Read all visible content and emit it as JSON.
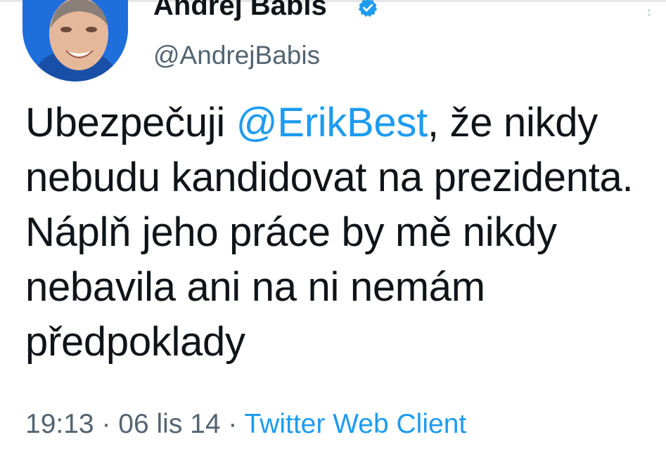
{
  "tweet": {
    "author": {
      "display_name": "Andrej Babiš",
      "handle": "@AndrejBabis",
      "verified": true,
      "verified_icon": "verified-badge-icon"
    },
    "text": {
      "before_mention": "Ubezpečuji ",
      "mention": "@ErikBest",
      "after_mention": ", že nikdy nebudu kandidovat na prezidenta. Náplň jeho práce by mě nikdy nebavila ani na ni nemám předpoklady"
    },
    "meta": {
      "time": "19:13",
      "separator_1": " · ",
      "date": "06 lis 14",
      "separator_2": " · ",
      "source": "Twitter Web Client"
    }
  },
  "colors": {
    "text": "#0f1419",
    "secondary": "#536471",
    "link": "#1d9bf0",
    "verified": "#1d9bf0"
  }
}
